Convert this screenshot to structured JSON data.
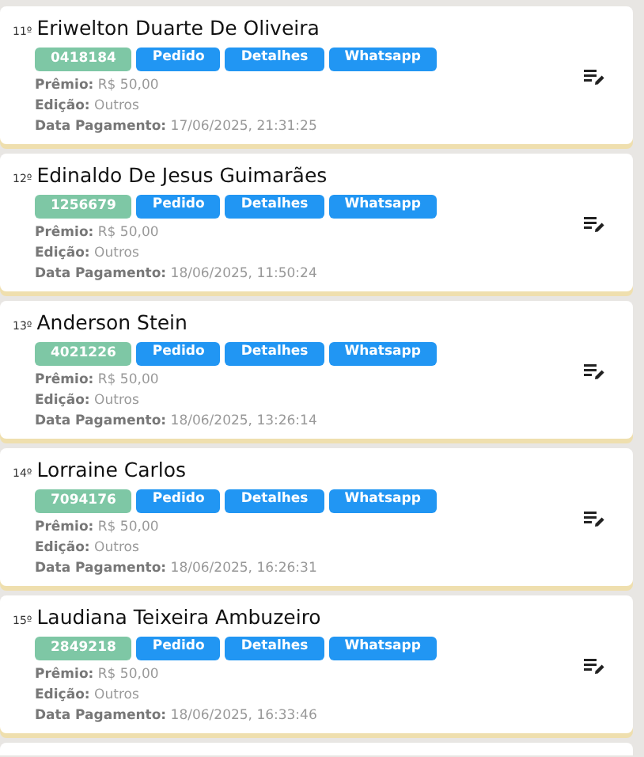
{
  "entries": [
    {
      "rank": "11º",
      "name": "Eriwelton Duarte De Oliveira",
      "code": "0418184",
      "buttons": [
        "Pedido",
        "Detalhes",
        "Whatsapp"
      ],
      "fields": [
        {
          "label": "Prêmio:",
          "value": "R$ 50,00"
        },
        {
          "label": "Edição:",
          "value": "Outros"
        },
        {
          "label": "Data Pagamento:",
          "value": "17/06/2025, 21:31:25"
        }
      ]
    },
    {
      "rank": "12º",
      "name": "Edinaldo De Jesus Guimarães",
      "code": "1256679",
      "buttons": [
        "Pedido",
        "Detalhes",
        "Whatsapp"
      ],
      "fields": [
        {
          "label": "Prêmio:",
          "value": "R$ 50,00"
        },
        {
          "label": "Edição:",
          "value": "Outros"
        },
        {
          "label": "Data Pagamento:",
          "value": "18/06/2025, 11:50:24"
        }
      ]
    },
    {
      "rank": "13º",
      "name": "Anderson Stein",
      "code": "4021226",
      "buttons": [
        "Pedido",
        "Detalhes",
        "Whatsapp"
      ],
      "fields": [
        {
          "label": "Prêmio:",
          "value": "R$ 50,00"
        },
        {
          "label": "Edição:",
          "value": "Outros"
        },
        {
          "label": "Data Pagamento:",
          "value": "18/06/2025, 13:26:14"
        }
      ]
    },
    {
      "rank": "14º",
      "name": "Lorraine Carlos",
      "code": "7094176",
      "buttons": [
        "Pedido",
        "Detalhes",
        "Whatsapp"
      ],
      "fields": [
        {
          "label": "Prêmio:",
          "value": "R$ 50,00"
        },
        {
          "label": "Edição:",
          "value": "Outros"
        },
        {
          "label": "Data Pagamento:",
          "value": "18/06/2025, 16:26:31"
        }
      ]
    },
    {
      "rank": "15º",
      "name": "Laudiana Teixeira Ambuzeiro",
      "code": "2849218",
      "buttons": [
        "Pedido",
        "Detalhes",
        "Whatsapp"
      ],
      "fields": [
        {
          "label": "Prêmio:",
          "value": "R$ 50,00"
        },
        {
          "label": "Edição:",
          "value": "Outros"
        },
        {
          "label": "Data Pagamento:",
          "value": "18/06/2025, 16:33:46"
        }
      ]
    }
  ]
}
